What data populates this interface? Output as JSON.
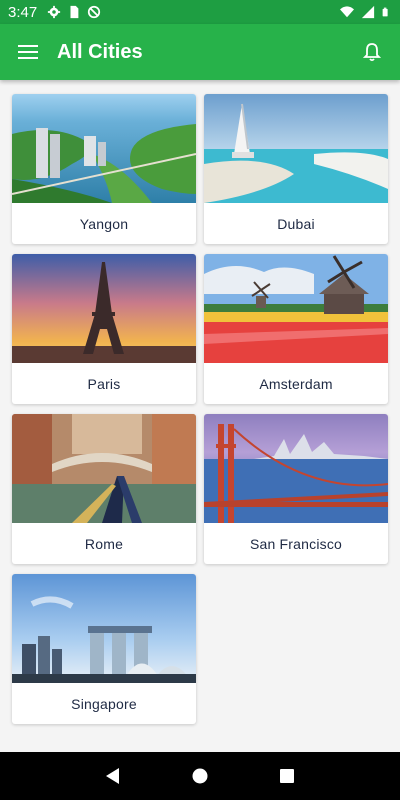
{
  "status_bar": {
    "time": "3:47",
    "icons": [
      "gear-icon",
      "sim-card-icon",
      "data-saver-icon",
      "wifi-icon",
      "signal-icon",
      "battery-icon"
    ]
  },
  "app_bar": {
    "title": "All Cities",
    "menu_icon": "hamburger-menu-icon",
    "notification_icon": "bell-icon",
    "color": "#27b24a"
  },
  "cities": [
    {
      "name": "Yangon",
      "image": "aerial city with river and greenery"
    },
    {
      "name": "Dubai",
      "image": "Burj Al Arab beach and marina"
    },
    {
      "name": "Paris",
      "image": "Eiffel Tower at sunset"
    },
    {
      "name": "Amsterdam",
      "image": "windmills and tulip fields"
    },
    {
      "name": "Rome",
      "image": "gondola under canal bridge"
    },
    {
      "name": "San Francisco",
      "image": "Golden Gate Bridge and skyline"
    },
    {
      "name": "Singapore",
      "image": "Marina Bay Sands skyline"
    }
  ],
  "nav_bar": {
    "back_icon": "back-triangle-icon",
    "home_icon": "home-circle-icon",
    "recents_icon": "recents-square-icon"
  }
}
